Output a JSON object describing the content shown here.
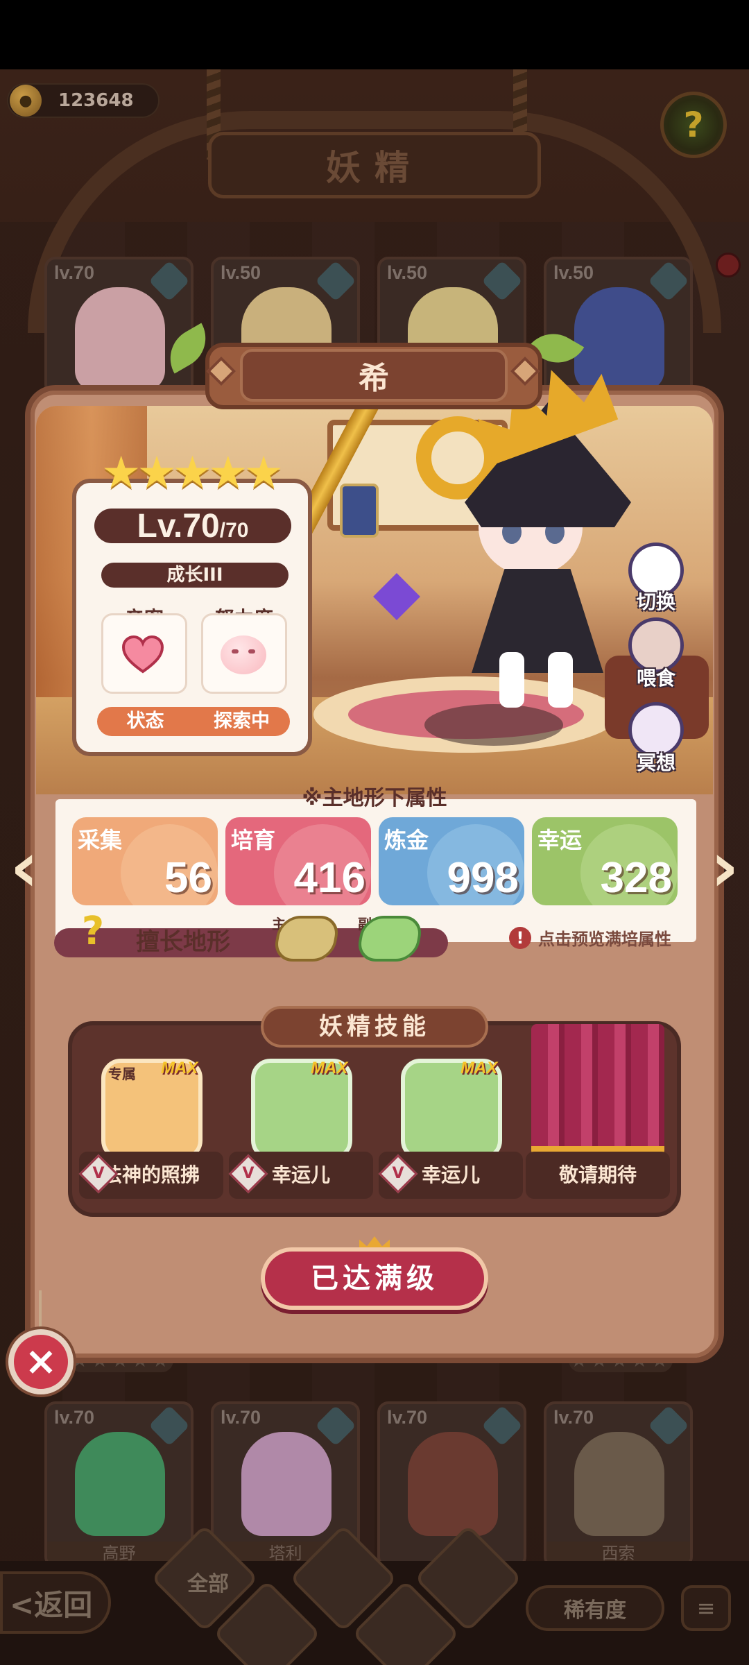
{
  "top": {
    "coins": "123648",
    "screen_title": "妖精"
  },
  "background_cards_top": [
    {
      "level": "lv.70",
      "color": "#caa0a4"
    },
    {
      "level": "lv.50",
      "color": "#c9b07c"
    },
    {
      "level": "lv.50",
      "color": "#c7b47a"
    },
    {
      "level": "lv.50",
      "color": "#3f4c8a"
    }
  ],
  "background_cards_bottom": [
    {
      "level": "lv.70",
      "name": "高野",
      "color": "#3f8a5a"
    },
    {
      "level": "lv.70",
      "name": "塔利",
      "color": "#b089a8"
    },
    {
      "level": "lv.70",
      "name": "",
      "color": "#6a3a30"
    },
    {
      "level": "lv.70",
      "name": "西索",
      "color": "#6a5a4a"
    }
  ],
  "background_star_rows": [
    "★★★★★",
    "★★★★★",
    "★★★★★",
    "★★★★★"
  ],
  "fairy": {
    "name": "希",
    "stars": "★★★★★",
    "level": "Lv.70",
    "level_max": "/70",
    "growth": "成长III",
    "intimacy_label": "亲密",
    "effort_label": "努力度",
    "state_label": "状态",
    "state_value": "探索中"
  },
  "actions": {
    "switch": "切换",
    "feed": "喂食",
    "meditate": "冥想"
  },
  "attributes": {
    "title": "※主地形下属性",
    "items": [
      {
        "label": "采集",
        "value": "56",
        "color": "#f0a979",
        "deco": "#f6c8a0"
      },
      {
        "label": "培育",
        "value": "416",
        "color": "#e4687c",
        "deco": "#f2a0a8"
      },
      {
        "label": "炼金",
        "value": "998",
        "color": "#6fa8d8",
        "deco": "#9fcbec"
      },
      {
        "label": "幸运",
        "value": "328",
        "color": "#9cc468",
        "deco": "#c4e09a"
      }
    ],
    "terrain_label": "擅长地形",
    "terrain_main_tag": "主",
    "terrain_sub_tag": "副",
    "preview_hint": "点击预览满培属性"
  },
  "skills": {
    "header": "妖精技能",
    "exclusive_tag": "专属",
    "max_tag": "MAX",
    "vip_badge": "V",
    "items": [
      {
        "name": "法神的照拂",
        "color": "#f4c27a"
      },
      {
        "name": "幸运儿",
        "color": "#a6d486"
      },
      {
        "name": "幸运儿",
        "color": "#a6d486"
      },
      {
        "name": "敬请期待",
        "color": ""
      }
    ]
  },
  "buttons": {
    "maxed": "已达满级",
    "close": "×",
    "back": "<返回",
    "filter_all": "全部",
    "rarity": "稀有度",
    "sort": "≡"
  },
  "nav": {
    "prev": "‹",
    "next": "›"
  }
}
